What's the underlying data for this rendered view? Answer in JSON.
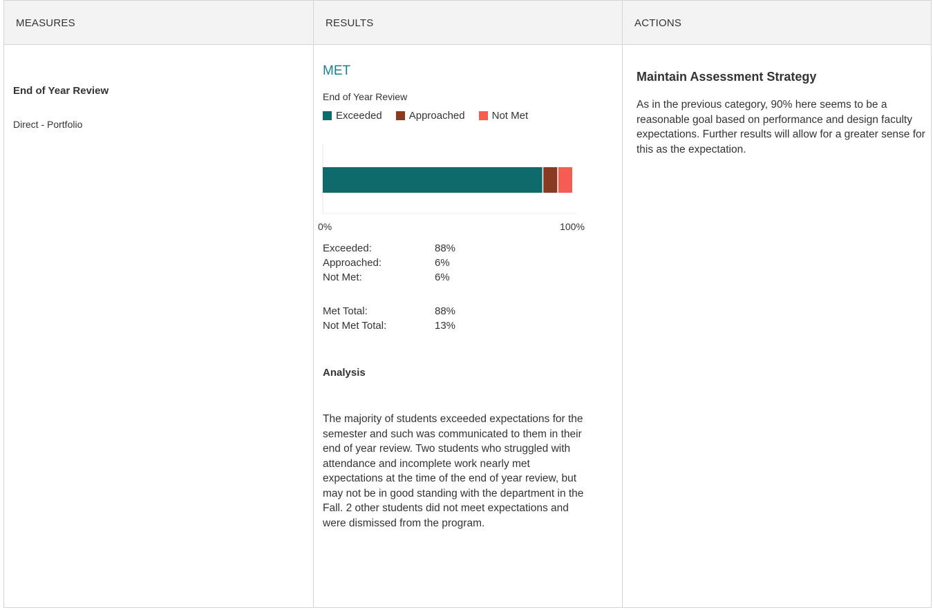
{
  "headers": {
    "measures": "MEASURES",
    "results": "RESULTS",
    "actions": "ACTIONS"
  },
  "measure": {
    "title": "End of Year Review",
    "type": "Direct - Portfolio"
  },
  "result": {
    "status": "MET",
    "status_color": "#1a7f86",
    "chart_title": "End of Year Review",
    "legend": [
      {
        "label": "Exceeded",
        "color": "#0f6a6b"
      },
      {
        "label": "Approached",
        "color": "#8b3a22"
      },
      {
        "label": "Not Met",
        "color": "#f45d51"
      }
    ],
    "axis": {
      "min_label": "0%",
      "max_label": "100%"
    },
    "stats": [
      {
        "label": "Exceeded:",
        "value": "88%"
      },
      {
        "label": "Approached:",
        "value": "6%"
      },
      {
        "label": "Not Met:",
        "value": "6%"
      }
    ],
    "totals": [
      {
        "label": "Met Total:",
        "value": "88%"
      },
      {
        "label": "Not Met Total:",
        "value": "13%"
      }
    ],
    "analysis_heading": "Analysis",
    "analysis_text": "The majority of students exceeded expectations for the semester and such was communicated to them in their end of year review. Two students who struggled with attendance and incomplete work nearly met expectations at the time of the end of year review, but may not be in good standing with the department in the Fall. 2 other students did not meet expectations and were dismissed from the program."
  },
  "action": {
    "title": "Maintain Assessment Strategy",
    "text": "As in the previous category, 90% here seems to be a reasonable goal based on performance and design faculty expectations. Further results will allow for a greater sense for this as the expectation."
  },
  "chart_data": {
    "type": "bar",
    "orientation": "horizontal",
    "stacked": true,
    "categories": [
      "End of Year Review"
    ],
    "series": [
      {
        "name": "Exceeded",
        "values": [
          88
        ],
        "color": "#0f6a6b"
      },
      {
        "name": "Approached",
        "values": [
          6
        ],
        "color": "#8b3a22"
      },
      {
        "name": "Not Met",
        "values": [
          6
        ],
        "color": "#f45d51"
      }
    ],
    "xlim": [
      0,
      100
    ],
    "tick_labels": [
      "0%",
      "100%"
    ],
    "title": "End of Year Review",
    "grid": false,
    "legend_position": "top-left"
  }
}
